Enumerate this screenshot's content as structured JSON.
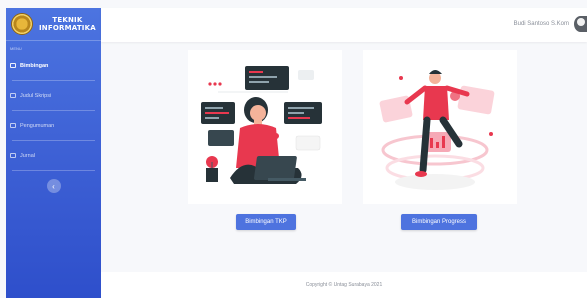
{
  "sidebar": {
    "brand": {
      "line1": "TEKNIK",
      "line2": "INFORMATIKA"
    },
    "section_label": "Menu",
    "items": [
      {
        "label": "Bimbingan",
        "icon": "list-icon",
        "active": true
      },
      {
        "label": "Judul Skripsi",
        "icon": "document-icon",
        "active": false
      },
      {
        "label": "Pengumuman",
        "icon": "megaphone-icon",
        "active": false
      },
      {
        "label": "Jurnal",
        "icon": "book-icon",
        "active": false
      }
    ],
    "toggle_icon": "‹"
  },
  "topbar": {
    "user_name": "Budi Santoso S.Kom"
  },
  "cards": [
    {
      "button_label": "Bimbingan TKP"
    },
    {
      "button_label": "Bimbingan Progress"
    }
  ],
  "footer": {
    "copyright": "Copyright © Untag Surabaya 2021"
  },
  "colors": {
    "primary": "#4e73df",
    "sidebar_top": "#4c74e0",
    "sidebar_bottom": "#2e4fcb",
    "accent_red": "#e8384f"
  }
}
